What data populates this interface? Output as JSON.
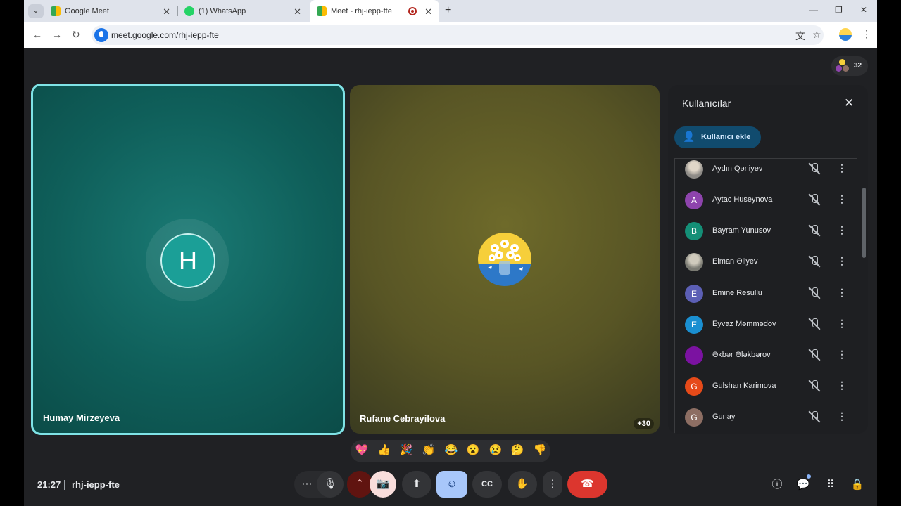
{
  "browser": {
    "tabs": [
      {
        "title": "Google Meet",
        "favicon": "google-meet-icon"
      },
      {
        "title": "(1) WhatsApp",
        "favicon": "whatsapp-icon"
      },
      {
        "title": "Meet - rhj-iepp-fte",
        "favicon": "google-meet-icon",
        "active": true,
        "recording": true
      }
    ],
    "url": "meet.google.com/rhj-iepp-fte"
  },
  "meeting": {
    "participant_count": "32",
    "tiles": [
      {
        "name": "Humay Mirzeyeva",
        "initial": "H",
        "avatar_color": "#1b9f97",
        "speaking": true
      },
      {
        "name": "Rufane Cebrayilova",
        "avatar": "flower-photo",
        "overflow": "+30"
      }
    ],
    "time": "21:27",
    "code": "rhj-iepp-fte"
  },
  "people_panel": {
    "title": "Kullanıcılar",
    "add_label": "Kullanıcı ekle",
    "participants": [
      {
        "name": "Aydın Qəniyev",
        "initial": "",
        "color": "#8d8a86",
        "photo": true
      },
      {
        "name": "Aytac Huseynova",
        "initial": "A",
        "color": "#8e44ad"
      },
      {
        "name": "Bayram Yunusov",
        "initial": "B",
        "color": "#148f77"
      },
      {
        "name": "Elman Əliyev",
        "initial": "",
        "color": "#7a7a72",
        "photo": true
      },
      {
        "name": "Emine Resullu",
        "initial": "E",
        "color": "#5c5fb5"
      },
      {
        "name": "Eyvaz Məmmədov",
        "initial": "E",
        "color": "#1a8fd1"
      },
      {
        "name": "Əkbər Ələkbərov",
        "initial": "",
        "color": "#7b12a1"
      },
      {
        "name": "Gulshan Karimova",
        "initial": "G",
        "color": "#e64a19"
      },
      {
        "name": "Gunay",
        "initial": "G",
        "color": "#8d6e63"
      }
    ]
  },
  "reactions": [
    "💖",
    "👍",
    "🎉",
    "👏",
    "😂",
    "😮",
    "😢",
    "🤔",
    "👎"
  ],
  "controls": {
    "more": "⋯",
    "mic": "🎙",
    "cam_options": "⌃",
    "camera": "📷",
    "present": "⬆",
    "emoji": "☺",
    "captions": "CC",
    "hand": "✋",
    "more_options": "⋮",
    "end_call": "☎"
  }
}
